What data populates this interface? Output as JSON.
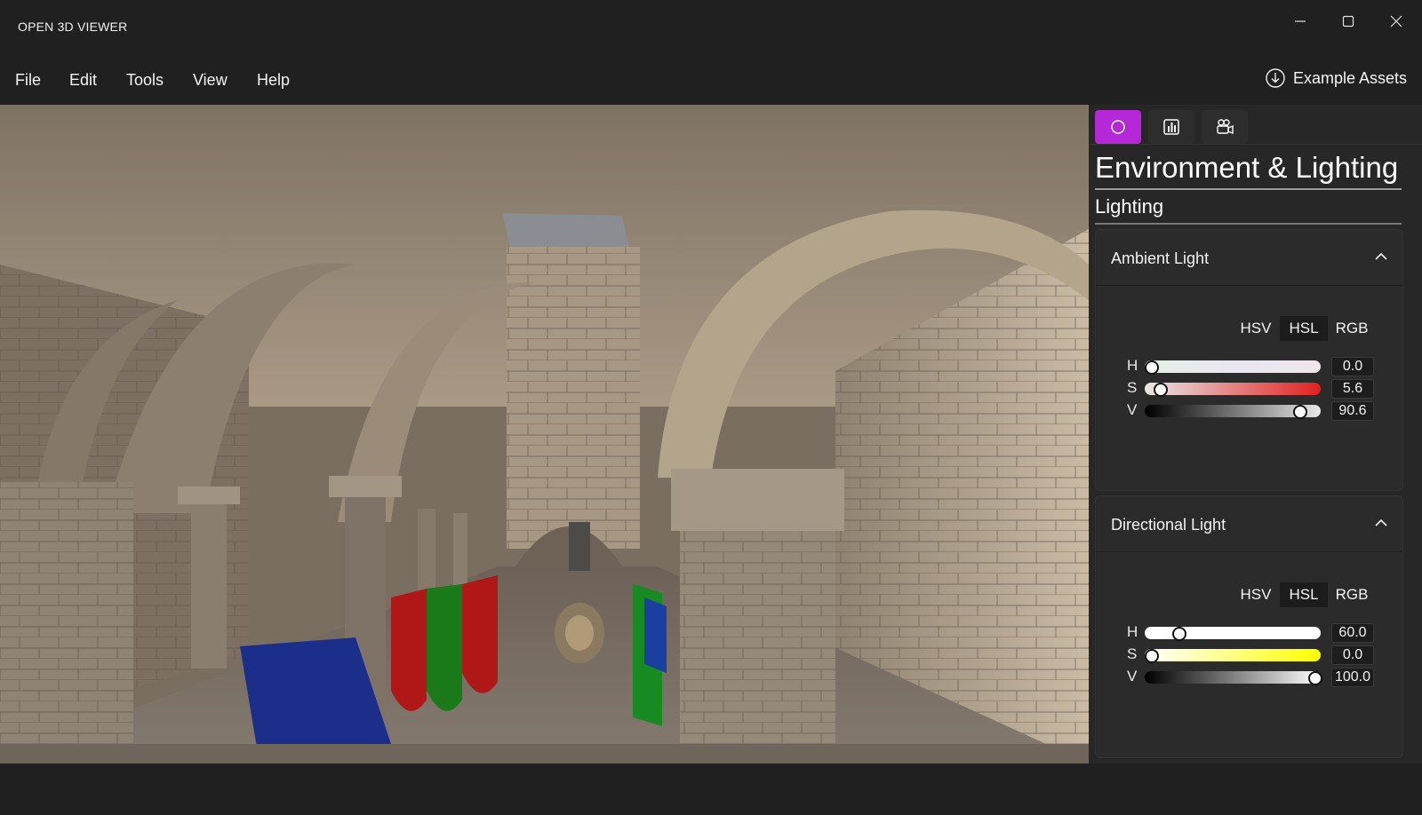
{
  "app": {
    "title": "OPEN 3D VIEWER"
  },
  "menu": {
    "items": [
      "File",
      "Edit",
      "Tools",
      "View",
      "Help"
    ],
    "example_assets": "Example Assets"
  },
  "tabs": [
    {
      "icon": "circle-icon",
      "active": true
    },
    {
      "icon": "stats-icon",
      "active": false
    },
    {
      "icon": "camera-icon",
      "active": false
    }
  ],
  "panel": {
    "title": "Environment & Lighting",
    "section": "Lighting",
    "ambient": {
      "title": "Ambient Light",
      "modes": [
        "HSV",
        "HSL",
        "RGB"
      ],
      "selected_mode": "HSL",
      "sliders": [
        {
          "label": "H",
          "value": "0.0",
          "fraction": 0.0
        },
        {
          "label": "S",
          "value": "5.6",
          "fraction": 0.056
        },
        {
          "label": "V",
          "value": "90.6",
          "fraction": 0.906
        }
      ]
    },
    "directional": {
      "title": "Directional Light",
      "modes": [
        "HSV",
        "HSL",
        "RGB"
      ],
      "selected_mode": "HSL",
      "sliders": [
        {
          "label": "H",
          "value": "60.0",
          "fraction": 0.1667
        },
        {
          "label": "S",
          "value": "0.0",
          "fraction": 0.0
        },
        {
          "label": "V",
          "value": "100.0",
          "fraction": 1.0
        }
      ]
    }
  },
  "colors": {
    "accent": "#b428d8",
    "background": "#202020",
    "panel": "#272727"
  }
}
